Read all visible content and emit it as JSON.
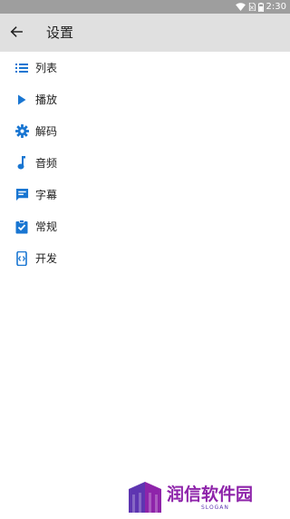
{
  "status_bar": {
    "time": "2:30",
    "icons": [
      "wifi-icon",
      "sim-icon",
      "battery-icon"
    ]
  },
  "app_bar": {
    "back_icon": "arrow-back-icon",
    "title": "设置"
  },
  "menu": {
    "items": [
      {
        "label": "列表",
        "icon": "list-icon"
      },
      {
        "label": "播放",
        "icon": "play-icon"
      },
      {
        "label": "解码",
        "icon": "gear-icon"
      },
      {
        "label": "音频",
        "icon": "music-note-icon"
      },
      {
        "label": "字幕",
        "icon": "subtitles-icon"
      },
      {
        "label": "常规",
        "icon": "clipboard-check-icon"
      },
      {
        "label": "开发",
        "icon": "developer-icon"
      }
    ]
  },
  "watermark": {
    "text": "润信软件园",
    "slogan": "SLOGAN"
  },
  "colors": {
    "accent": "#1976d2",
    "app_bar_bg": "#e0e0e0",
    "status_bar_bg": "#9e9e9e",
    "watermark": "#8e24aa"
  }
}
